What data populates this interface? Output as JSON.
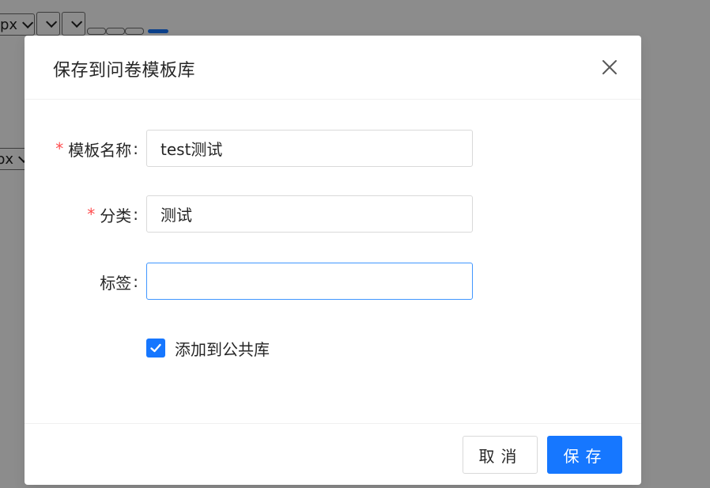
{
  "background": {
    "unit_select_1": "px",
    "unit_select_2": "px"
  },
  "modal": {
    "title": "保存到问卷模板库",
    "fields": [
      {
        "label": "模板名称",
        "colon": ":",
        "required": true,
        "value": "test测试",
        "placeholder": ""
      },
      {
        "label": "分类",
        "colon": ":",
        "required": true,
        "value": "测试",
        "placeholder": ""
      },
      {
        "label": "标签",
        "colon": ":",
        "required": false,
        "value": "",
        "placeholder": ""
      }
    ],
    "checkbox": {
      "label": "添加到公共库",
      "checked": true
    },
    "footer": {
      "cancel_label": "取消",
      "save_label": "保存"
    }
  },
  "colors": {
    "primary": "#1677ff",
    "required": "#ff4d4f",
    "mask": "rgba(0,0,0,0.45)"
  },
  "icons": {
    "close": "close-icon",
    "check": "check-icon",
    "chevron": "chevron-down-icon"
  }
}
